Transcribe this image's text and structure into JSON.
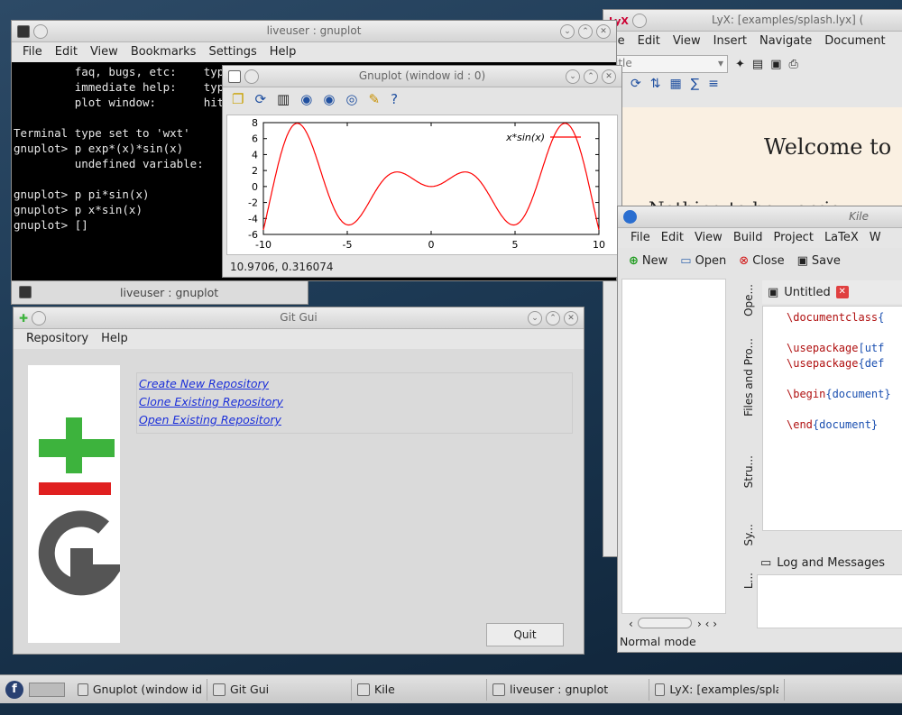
{
  "terminal": {
    "title": "liveuser : gnuplot",
    "menu": [
      "File",
      "Edit",
      "View",
      "Bookmarks",
      "Settings",
      "Help"
    ],
    "lines": [
      "         faq, bugs, etc:    type",
      "         immediate help:    type",
      "         plot window:       hit",
      "",
      "Terminal type set to 'wxt'",
      "gnuplot> p exp*(x)*sin(x)",
      "         undefined variable:",
      "",
      "gnuplot> p pi*sin(x)",
      "gnuplot> p x*sin(x)",
      "gnuplot> []"
    ],
    "task_title": "liveuser : gnuplot"
  },
  "gnuplot": {
    "title": "Gnuplot (window id : 0)",
    "status": "10.9706, 0.316074",
    "legend": "x*sin(x)",
    "xticks": [
      "-10",
      "-5",
      "0",
      "5",
      "10"
    ],
    "yticks": [
      "8",
      "6",
      "4",
      "2",
      "0",
      "-2",
      "-4",
      "-6"
    ]
  },
  "chart_data": {
    "type": "line",
    "series": [
      {
        "name": "x*sin(x)",
        "function": "x*sin(x)"
      }
    ],
    "xlim": [
      -10,
      10
    ],
    "ylim": [
      -6,
      8
    ]
  },
  "lyx": {
    "title": "LyX: [examples/splash.lyx] (",
    "menu": [
      "le",
      "Edit",
      "View",
      "Insert",
      "Navigate",
      "Document"
    ],
    "combo": "itle",
    "heading": "Welcome to",
    "body_fragment": "Nothing to be worrie"
  },
  "kile": {
    "title": "Kile",
    "menu": [
      "File",
      "Edit",
      "View",
      "Build",
      "Project",
      "LaTeX",
      "W"
    ],
    "buttons": {
      "new": "New",
      "open": "Open",
      "close": "Close",
      "save": "Save"
    },
    "tab": "Untitled",
    "side_tabs": [
      "Ope...",
      "Files and Pro...",
      "Stru...",
      "Sy...",
      "L..."
    ],
    "code": [
      {
        "cmd": "\\documentclass",
        "arg": "{"
      },
      {
        "cmd": "",
        "arg": ""
      },
      {
        "cmd": "\\usepackage",
        "arg": "[utf"
      },
      {
        "cmd": "\\usepackage",
        "arg": "{def"
      },
      {
        "cmd": "",
        "arg": ""
      },
      {
        "cmd": "\\begin",
        "arg": "{document}"
      },
      {
        "cmd": "",
        "arg": ""
      },
      {
        "cmd": "\\end",
        "arg": "{document}"
      }
    ],
    "log_tab": "Log and Messages",
    "status": "Normal mode"
  },
  "git": {
    "title": "Git Gui",
    "menu": [
      "Repository",
      "Help"
    ],
    "links": [
      "Create New Repository",
      "Clone Existing Repository",
      "Open Existing Repository"
    ],
    "quit": "Quit"
  },
  "taskbar": {
    "items": [
      "Gnuplot (window id : 0)",
      "Git Gui",
      "Kile",
      "liveuser : gnuplot",
      "LyX: [examples/splash.ly"
    ]
  },
  "colors": {
    "plot_line": "#ff0000",
    "git_green": "#3db33d",
    "git_red": "#e02020",
    "git_gray": "#555555",
    "link": "#1b2fd9"
  }
}
